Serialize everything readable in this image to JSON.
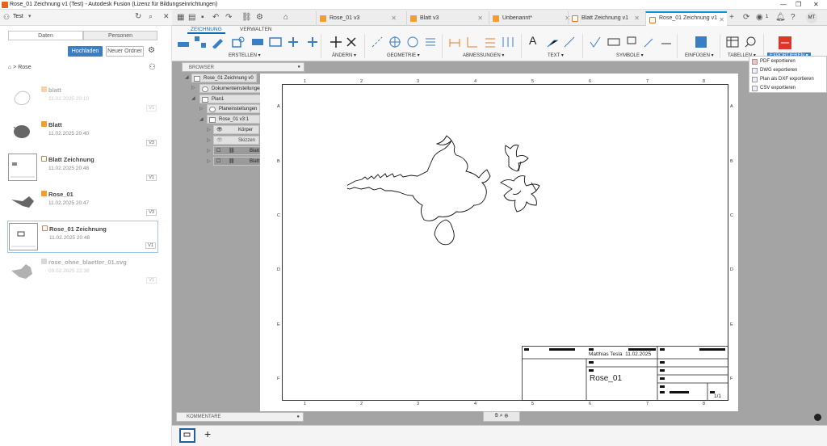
{
  "window": {
    "title": "Rose_01 Zeichnung v1 (Test) - Autodesk Fusion (Lizenz für Bildungseinrichtungen)"
  },
  "left_header": {
    "project": "Test"
  },
  "tabs": [
    {
      "label": "Rose_01 v3"
    },
    {
      "label": "Blatt v3"
    },
    {
      "label": "Unbenannt*"
    },
    {
      "label": "Blatt Zeichnung v1"
    },
    {
      "label": "Rose_01 Zeichnung v1"
    }
  ],
  "header_right": {
    "jobs": "1",
    "user": "MT"
  },
  "panel": {
    "seg_data": "Daten",
    "seg_people": "Personen",
    "upload": "Hochladen",
    "new_folder": "Neuer Ordner",
    "breadcrumb": "Rose",
    "files": [
      {
        "name": "blatt",
        "date": "11.02.2025 20:10",
        "version": "V1"
      },
      {
        "name": "Blatt",
        "date": "11.02.2025 20:40",
        "version": "V3"
      },
      {
        "name": "Blatt Zeichnung",
        "date": "11.02.2025 20:48",
        "version": "V1"
      },
      {
        "name": "Rose_01",
        "date": "11.02.2025 20:47",
        "version": "V3"
      },
      {
        "name": "Rose_01 Zeichnung",
        "date": "11.02.2025 20:48",
        "version": "V1"
      },
      {
        "name": "rose_ohne_blaetter_01.svg",
        "date": "09.02.2025 22:38",
        "version": "V1"
      }
    ]
  },
  "toolbar": {
    "mode_tabs": [
      "ZEICHNUNG",
      "VERWALTEN"
    ],
    "groups": [
      "ERSTELLEN ▾",
      "ÄNDERN ▾",
      "GEOMETRIE ▾",
      "ABMESSUNGEN ▾",
      "TEXT ▾",
      "SYMBOLE ▾",
      "EINFÜGEN ▾",
      "TABELLEN ▾",
      "EXPORTIEREN ▾"
    ]
  },
  "browser": {
    "title": "BROWSER",
    "nodes": [
      "Rose_01 Zeichnung v0",
      "Dokumenteinstellungen",
      "Plan1",
      "Planeinstellungen",
      "Rose_01 v3:1",
      "Körper",
      "Skizzen",
      "Blatt v3:1",
      "Blatt v3:2"
    ]
  },
  "export_menu": {
    "items": [
      "PDF exportieren",
      "DWG exportieren",
      "Plan als DXF exportieren",
      "CSV exportieren"
    ]
  },
  "drawing": {
    "col_labels": [
      "1",
      "2",
      "3",
      "4",
      "5",
      "6",
      "7",
      "8"
    ],
    "row_labels": [
      "A",
      "B",
      "C",
      "D",
      "E",
      "F"
    ],
    "author": "Matthias Tesla",
    "date": "11.02.2025",
    "part_name": "Rose_01",
    "sheet_no": "1/1"
  },
  "comments": {
    "label": "KOMMENTARE"
  }
}
